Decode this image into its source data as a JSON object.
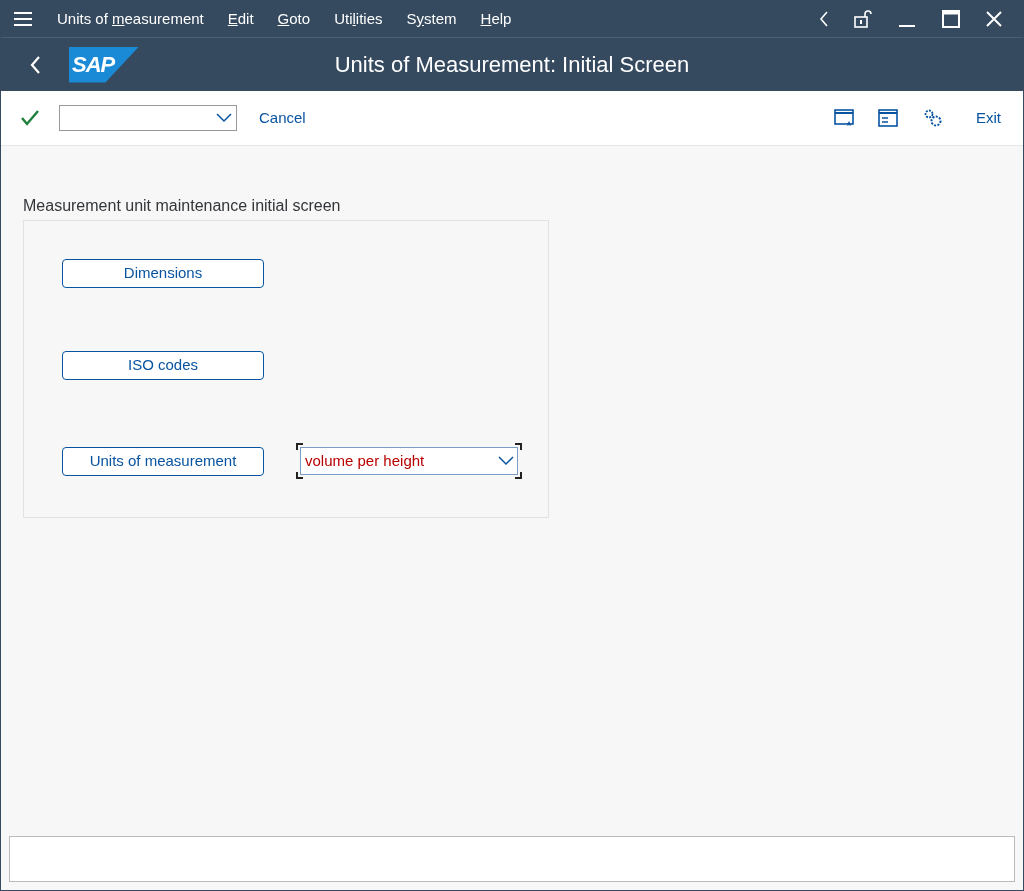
{
  "menu": [
    {
      "before": "Units of ",
      "key": "m",
      "after": "easurement"
    },
    {
      "key": "E",
      "after": "dit"
    },
    {
      "key": "G",
      "after": "oto"
    },
    {
      "before": "Uti",
      "key": "l",
      "after": "ities"
    },
    {
      "before": "S",
      "key": "y",
      "after": "stem"
    },
    {
      "key": "H",
      "after": "elp"
    }
  ],
  "logo": "SAP",
  "title": "Units of Measurement: Initial Screen",
  "toolbar": {
    "cancel": "Cancel",
    "exit": "Exit"
  },
  "group": {
    "title": "Measurement unit maintenance initial screen",
    "buttons": [
      "Dimensions",
      "ISO codes",
      "Units of measurement"
    ],
    "dropdown": {
      "value": "volume per height",
      "focused": true
    }
  }
}
